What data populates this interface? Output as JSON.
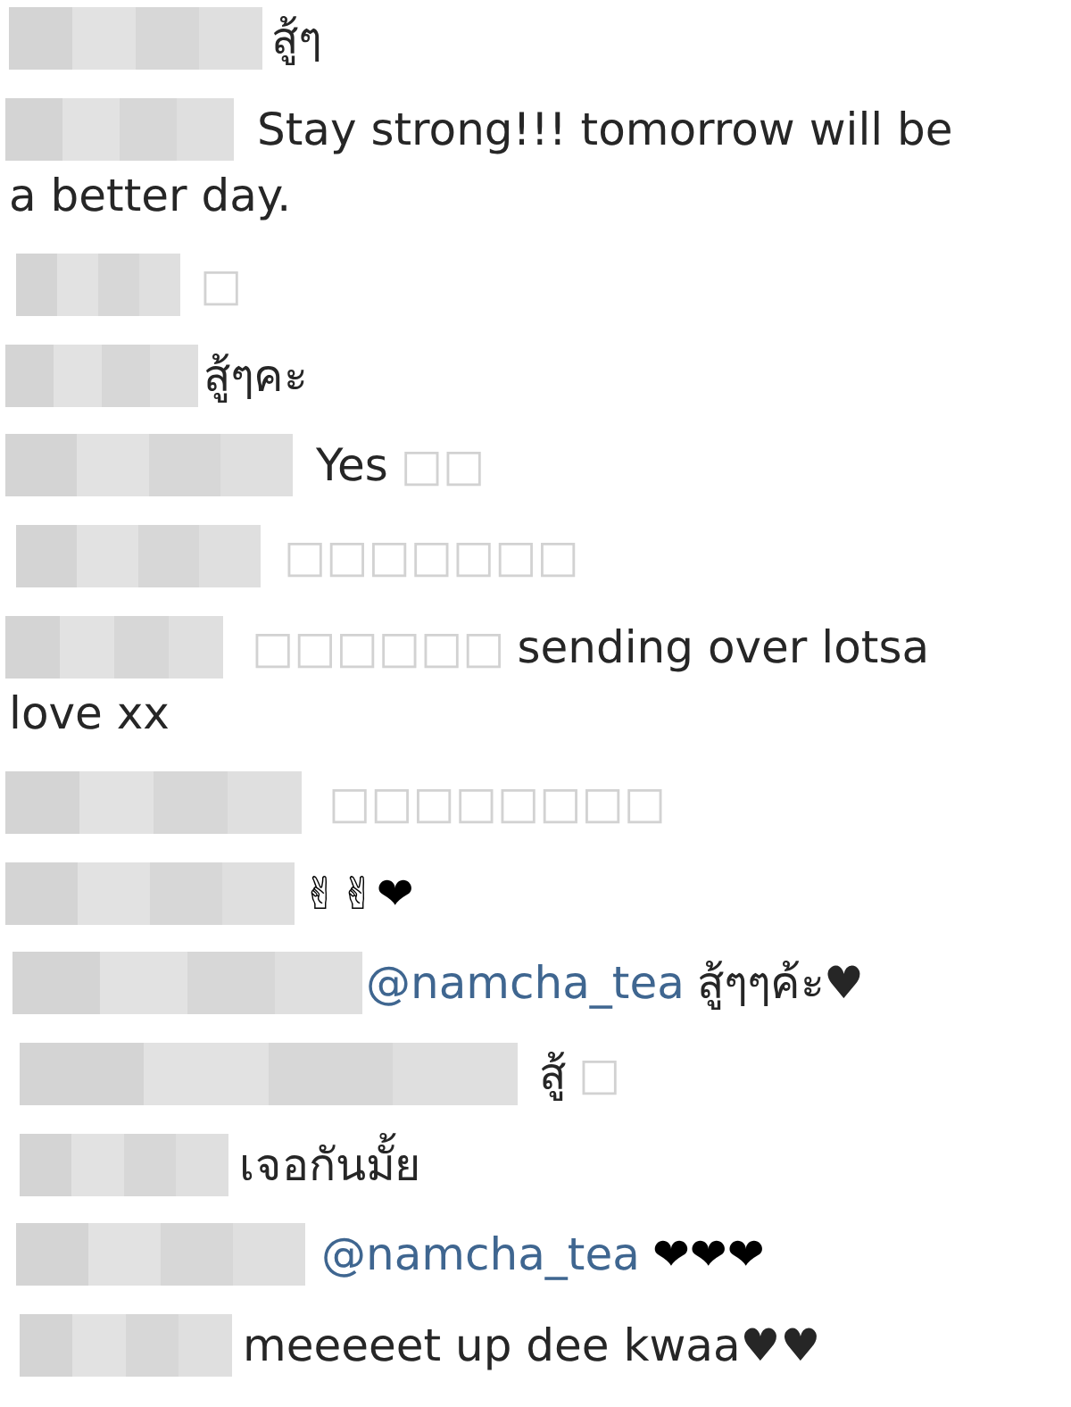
{
  "comments": [
    {
      "segments": [
        {
          "kind": "text",
          "text": "สู้ๆ"
        }
      ]
    },
    {
      "segments": [
        {
          "kind": "text",
          "text": "Stay strong!!! tomorrow will be"
        }
      ],
      "continued": "a better day."
    },
    {
      "segments": [
        {
          "kind": "missing_glyph",
          "text": "□"
        }
      ]
    },
    {
      "segments": [
        {
          "kind": "text",
          "text": "สู้ๆคะ"
        }
      ]
    },
    {
      "segments": [
        {
          "kind": "text",
          "text": "Yes"
        },
        {
          "kind": "missing_glyph",
          "text": "□□"
        }
      ]
    },
    {
      "segments": [
        {
          "kind": "missing_glyph",
          "text": "□□□□□□□"
        }
      ]
    },
    {
      "segments": [
        {
          "kind": "missing_glyph",
          "text": "□□□□□□"
        },
        {
          "kind": "text",
          "text": "sending over lotsa"
        }
      ],
      "continued": "love xx"
    },
    {
      "segments": [
        {
          "kind": "missing_glyph",
          "text": "□□□□□□□□"
        }
      ]
    },
    {
      "segments": [
        {
          "kind": "symbols",
          "text": "✌✌❤"
        }
      ]
    },
    {
      "segments": [
        {
          "kind": "mention",
          "text": "@namcha_tea"
        },
        {
          "kind": "text",
          "text": "สู้ๆๆค้ะ♥"
        }
      ]
    },
    {
      "segments": [
        {
          "kind": "text",
          "text": "สู้"
        },
        {
          "kind": "missing_glyph",
          "text": "□"
        }
      ]
    },
    {
      "segments": [
        {
          "kind": "text",
          "text": "เจอกันมั้ย"
        }
      ]
    },
    {
      "segments": [
        {
          "kind": "mention",
          "text": "@namcha_tea"
        },
        {
          "kind": "symbols",
          "text": "❤❤❤"
        }
      ]
    },
    {
      "segments": [
        {
          "kind": "text",
          "text": "meeeeet up dee kwaa♥♥"
        }
      ]
    }
  ]
}
